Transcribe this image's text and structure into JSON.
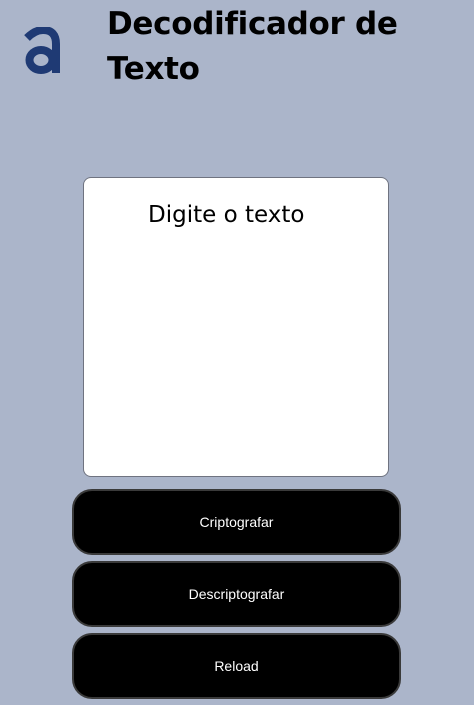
{
  "header": {
    "title": "Decodificador de Texto",
    "logo_icon": "alura-a-logo-icon",
    "logo_color": "#1f3a74"
  },
  "input": {
    "placeholder": "Digite o texto",
    "value": ""
  },
  "buttons": {
    "encrypt_label": "Criptografar",
    "decrypt_label": "Descriptografar",
    "reload_label": "Reload"
  },
  "colors": {
    "background": "#abb5ca",
    "button_background": "#000000",
    "button_text": "#ffffff"
  }
}
